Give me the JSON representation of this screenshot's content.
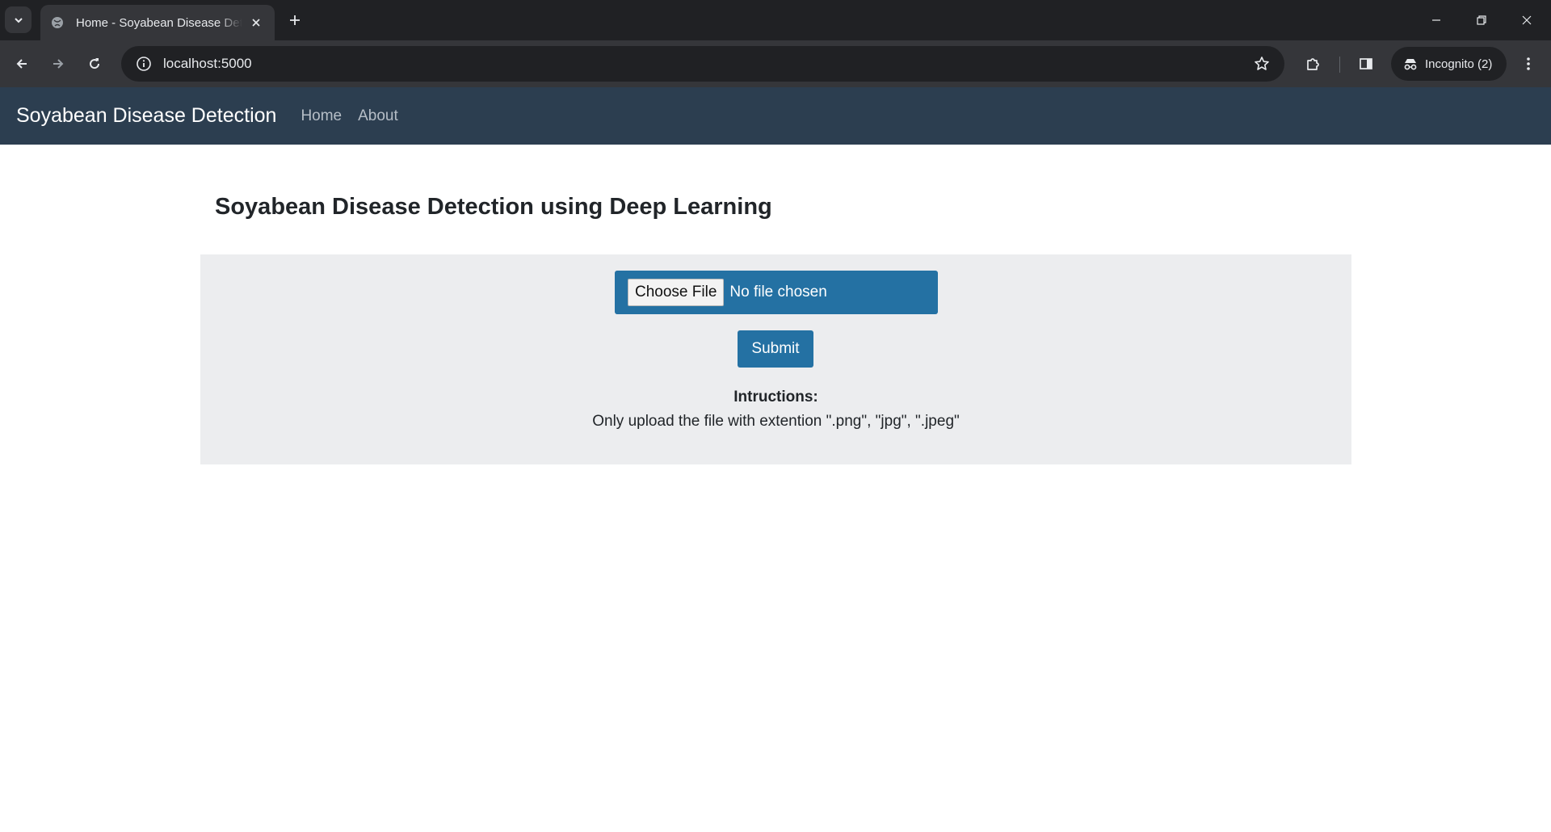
{
  "browser": {
    "tab_title": "Home - Soyabean Disease Detection",
    "url": "localhost:5000",
    "incognito_label": "Incognito (2)",
    "icons": {
      "tab_search": "chevron-down-icon",
      "favicon": "globe-icon",
      "tab_close": "close-icon",
      "new_tab": "plus-icon",
      "back": "arrow-left-icon",
      "forward": "arrow-right-icon",
      "reload": "reload-icon",
      "site_info": "info-icon",
      "bookmark": "star-icon",
      "extensions": "puzzle-icon",
      "side_panel": "side-panel-icon",
      "incognito": "incognito-icon",
      "menu": "kebab-menu-icon",
      "minimize": "minimize-icon",
      "restore": "restore-icon",
      "close_window": "close-icon"
    }
  },
  "navbar": {
    "brand": "Soyabean Disease Detection",
    "links": [
      "Home",
      "About"
    ],
    "background": "#2c3e50"
  },
  "main": {
    "heading": "Soyabean Disease Detection using Deep Learning",
    "file_input": {
      "button_label": "Choose File",
      "status": "No file chosen"
    },
    "submit_label": "Submit",
    "instructions_title": "Intructions:",
    "instructions_text": "Only upload the file with extention \".png\", \"jpg\", \".jpeg\"",
    "accent_color": "#2471a3",
    "panel_color": "#ecedef"
  }
}
